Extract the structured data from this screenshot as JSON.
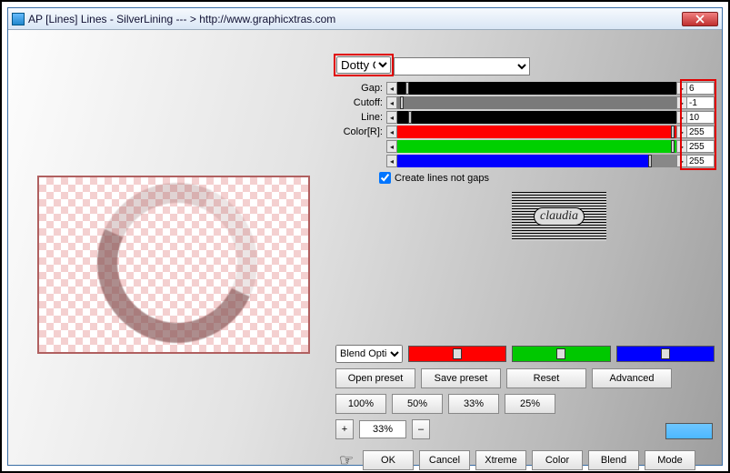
{
  "window": {
    "title": "AP [Lines]  Lines - SilverLining   --- > http://www.graphicxtras.com"
  },
  "dropdown": {
    "selected": "Dotty Grid"
  },
  "sliders": {
    "rows": [
      {
        "label": "Gap:",
        "bar": "black",
        "val": "6",
        "thumb": 3
      },
      {
        "label": "Cutoff:",
        "bar": "gray",
        "val": "-1",
        "thumb": 1
      },
      {
        "label": "Line:",
        "bar": "black",
        "val": "10",
        "thumb": 4
      },
      {
        "label": "Color[R]:",
        "bar": "red",
        "val": "255",
        "thumb": 98
      },
      {
        "label": "",
        "bar": "green",
        "val": "255",
        "thumb": 98
      },
      {
        "label": "",
        "bar": "blue",
        "val": "255",
        "thumb": 90
      }
    ]
  },
  "checkbox": {
    "label": "Create lines not gaps",
    "checked": true
  },
  "logo": {
    "text": "claudia"
  },
  "blend": {
    "label": "Blend Options"
  },
  "buttons": {
    "row1": [
      "Open preset",
      "Save preset",
      "Reset",
      "Advanced"
    ],
    "row2": [
      "100%",
      "50%",
      "33%",
      "25%"
    ],
    "zoom_plus": "+",
    "zoom_value": "33%",
    "zoom_minus": "–",
    "row4": [
      "OK",
      "Cancel",
      "Xtreme",
      "Color",
      "Blend",
      "Mode"
    ]
  }
}
